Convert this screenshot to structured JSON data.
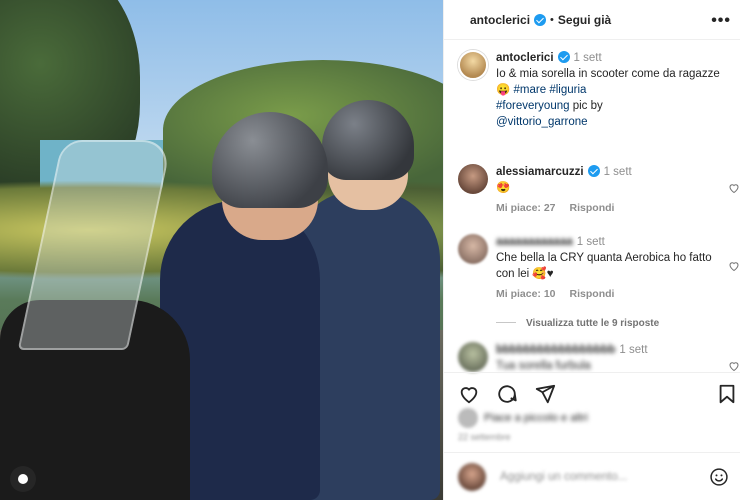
{
  "header": {
    "username": "antoclerici",
    "separator": "•",
    "follow_label": "Segui già",
    "more_label": "•••"
  },
  "caption": {
    "username": "antoclerici",
    "time": "1 sett",
    "text_prefix": "Io & mia sorella in scooter come da ragazze😛",
    "tag_mare": "#mare",
    "tag_liguria": "#liguria",
    "tag_foreveryoung": "#foreveryoung",
    "text_mid": "pic by",
    "mention": "@vittorio_garrone"
  },
  "comments": [
    {
      "username": "alessiamarcuzzi",
      "time": "1 sett",
      "text": "😍",
      "likes": "Mi piace: 27",
      "reply": "Rispondi"
    },
    {
      "username": "",
      "time": "1 sett",
      "text": "Che bella la CRY quanta Aerobica ho fatto con lei 🥰♥",
      "likes": "Mi piace: 10",
      "reply": "Rispondi"
    },
    {
      "username": "",
      "time": "1 sett",
      "text": "Tua sorella furbula"
    }
  ],
  "view_replies": "Visualizza tutte le 9 risposte",
  "likes_text": "Piace a piccolo e altri",
  "likes_date": "22 settembre",
  "add_comment_placeholder": "Aggiungi un commento...",
  "colors": {
    "verified": "#1d9bf0",
    "link": "#00376b",
    "muted": "#8e8e8e"
  },
  "icons": [
    "verified-badge-icon",
    "heart-icon",
    "comment-icon",
    "share-icon",
    "bookmark-icon",
    "emoji-icon",
    "user-icon"
  ]
}
